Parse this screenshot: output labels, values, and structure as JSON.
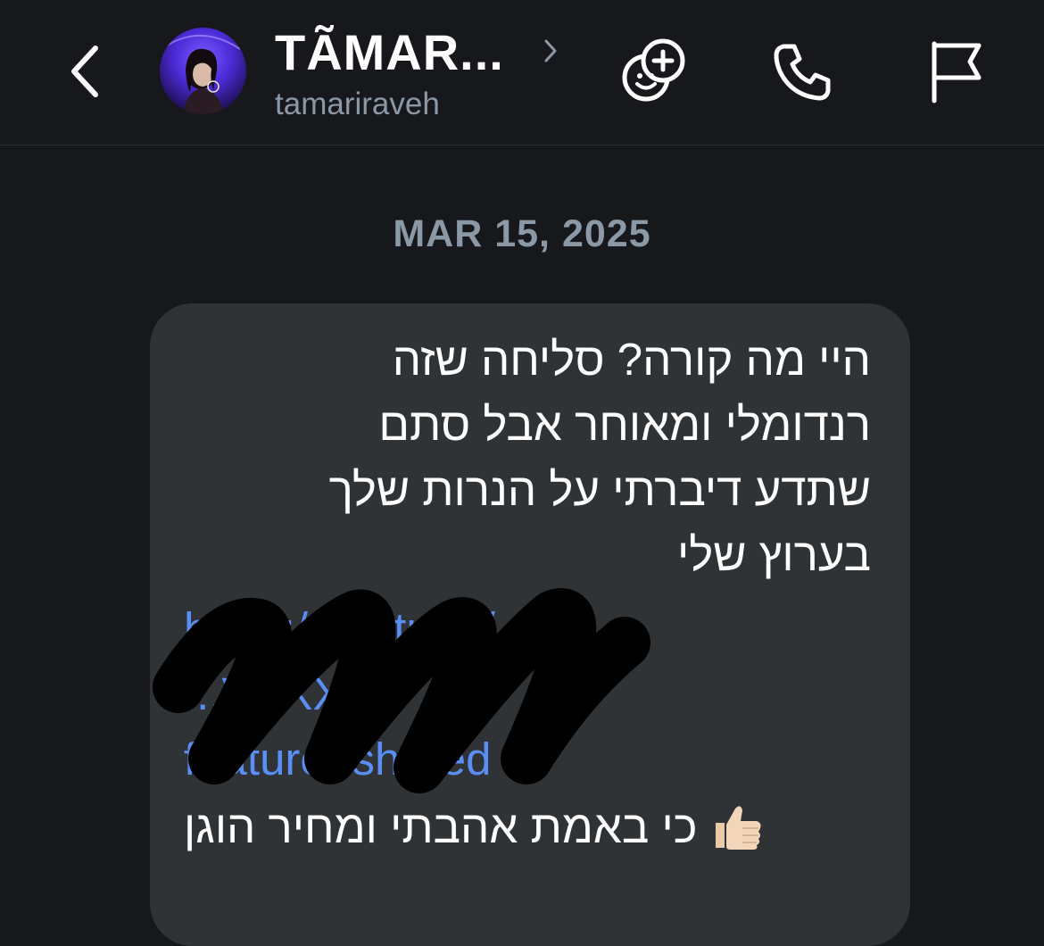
{
  "header": {
    "contact_name": "TÃMAR...",
    "contact_handle": "tamariraveh",
    "icons": {
      "back": "chevron-left-icon",
      "name_chevron": "chevron-right-icon",
      "add_people": "add-people-icon",
      "call": "phone-icon",
      "report": "flag-icon"
    }
  },
  "conversation": {
    "date_separator": "MAR 15, 2025",
    "message": {
      "lines": [
        "היי מה קורה? סליחה שזה",
        "רנדומלי ומאוחר אבל סתם",
        "שתדע דיברתי על הנרות שלך",
        "בערוץ שלי"
      ],
      "link_lines": [
        "https://youtube/",
        "...VXXXX",
        "feature=shared"
      ],
      "closing_text": "כי באמת אהבתי ומחיר הוגן",
      "closing_emoji": "thumbs-up-icon"
    }
  },
  "colors": {
    "background": "#16181c",
    "bubble": "#2f3336",
    "link": "#5b8ef5",
    "secondary_text": "#8b98a5"
  }
}
